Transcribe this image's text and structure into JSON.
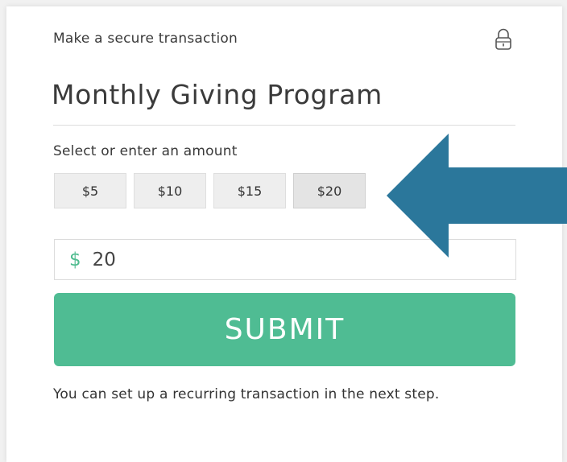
{
  "form": {
    "header": "Make a secure transaction",
    "lock_icon": "lock-icon",
    "title": "Monthly Giving Program",
    "amount_label": "Select or enter an amount",
    "amounts": [
      {
        "label": "$5"
      },
      {
        "label": "$10"
      },
      {
        "label": "$15"
      },
      {
        "label": "$20"
      }
    ],
    "selected_amount": "$20",
    "currency_symbol": "$",
    "amount_value": "20",
    "submit_label": "SUBMIT",
    "footer_note": "You can set up a recurring transaction in the next step."
  },
  "annotation": {
    "arrow_icon": "left-arrow-icon",
    "arrow_color": "#2b779b"
  },
  "colors": {
    "accent": "#4fbc93",
    "currency": "#4fbc8f"
  }
}
